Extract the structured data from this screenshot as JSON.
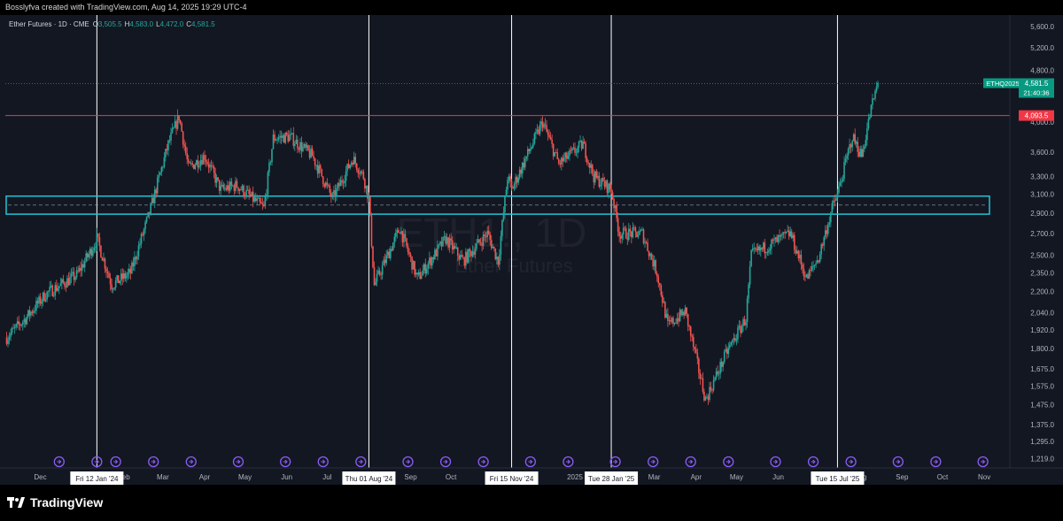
{
  "credit": "Bosslyfva created with TradingView.com, Aug 14, 2025 19:29 UTC-4",
  "footer": {
    "brand": "TradingView"
  },
  "legend": {
    "symbol": "Ether Futures · 1D · CME",
    "o_label": "O",
    "o_value": "3,505.5",
    "h_label": "H",
    "h_value": "4,583.0",
    "l_label": "L",
    "l_value": "4,472.0",
    "c_label": "C",
    "c_value": "4,581.5"
  },
  "watermark": {
    "symbol": "ETH1!, 1D",
    "name": "Ether Futures"
  },
  "colors": {
    "background": "#131722",
    "up": "#26a69a",
    "down": "#ef5350",
    "resistance": "#f23645",
    "zone": "#22c3d6",
    "price_badge": "#089981",
    "crosshair": "#ffffff"
  },
  "chart_data": {
    "type": "candlestick",
    "y_scale": "log",
    "ylim": [
      1180,
      5800
    ],
    "xlim": [
      "2023-11-05",
      "2025-11-20"
    ],
    "y_ticks": [
      "5,600.0",
      "5,200.0",
      "4,800.0",
      "4,000.0",
      "3,600.0",
      "3,300.0",
      "3,100.0",
      "2,900.0",
      "2,700.0",
      "2,500.0",
      "2,350.0",
      "2,200.0",
      "2,040.0",
      "1,920.0",
      "1,800.0",
      "1,675.0",
      "1,575.0",
      "1,475.0",
      "1,375.0",
      "1,295.0",
      "1,219.0"
    ],
    "x_ticks": [
      {
        "date": "2023-12-01",
        "label": "Dec"
      },
      {
        "date": "2024-02-01",
        "label": "Feb"
      },
      {
        "date": "2024-03-01",
        "label": "Mar"
      },
      {
        "date": "2024-04-01",
        "label": "Apr"
      },
      {
        "date": "2024-05-01",
        "label": "May"
      },
      {
        "date": "2024-06-01",
        "label": "Jun"
      },
      {
        "date": "2024-07-01",
        "label": "Jul"
      },
      {
        "date": "2024-09-01",
        "label": "Sep"
      },
      {
        "date": "2024-10-01",
        "label": "Oct"
      },
      {
        "date": "2025-01-01",
        "label": "2025"
      },
      {
        "date": "2025-03-01",
        "label": "Mar"
      },
      {
        "date": "2025-04-01",
        "label": "Apr"
      },
      {
        "date": "2025-05-01",
        "label": "May"
      },
      {
        "date": "2025-06-01",
        "label": "Jun"
      },
      {
        "date": "2025-08-01",
        "label": "Aug"
      },
      {
        "date": "2025-09-01",
        "label": "Sep"
      },
      {
        "date": "2025-10-01",
        "label": "Oct"
      },
      {
        "date": "2025-11-01",
        "label": "Nov"
      }
    ],
    "vertical_markers": [
      {
        "date": "2024-01-12",
        "label": "Fri 12 Jan '24"
      },
      {
        "date": "2024-08-01",
        "label": "Thu 01 Aug '24"
      },
      {
        "date": "2024-11-15",
        "label": "Fri 15 Nov '24"
      },
      {
        "date": "2025-01-28",
        "label": "Tue 28 Jan '25"
      },
      {
        "date": "2025-07-15",
        "label": "Tue 15 Jul '25"
      }
    ],
    "horizontal_line": {
      "price": 4093.5,
      "label": "4,093.5"
    },
    "zone": {
      "low": 2890,
      "high": 3080,
      "mid": 2985
    },
    "last_price": {
      "price": 4581.5,
      "symbol": "ETHQ2025",
      "label": "4,581.5",
      "countdown": "21:40:36"
    },
    "event_markers": [
      "2023-12-15",
      "2024-01-12",
      "2024-01-26",
      "2024-02-23",
      "2024-03-22",
      "2024-04-26",
      "2024-05-31",
      "2024-06-28",
      "2024-07-26",
      "2024-08-30",
      "2024-09-27",
      "2024-10-25",
      "2024-11-29",
      "2024-12-27",
      "2025-01-31",
      "2025-02-28",
      "2025-03-28",
      "2025-04-25",
      "2025-05-30",
      "2025-06-27",
      "2025-07-25",
      "2025-08-29",
      "2025-09-26",
      "2025-10-31"
    ],
    "anchors": [
      [
        "2023-11-06",
        1870
      ],
      [
        "2023-11-20",
        2000
      ],
      [
        "2023-12-05",
        2180
      ],
      [
        "2023-12-28",
        2330
      ],
      [
        "2024-01-08",
        2550
      ],
      [
        "2024-01-12",
        2650
      ],
      [
        "2024-01-23",
        2250
      ],
      [
        "2024-02-06",
        2350
      ],
      [
        "2024-02-20",
        2900
      ],
      [
        "2024-03-05",
        3700
      ],
      [
        "2024-03-13",
        4080
      ],
      [
        "2024-03-20",
        3400
      ],
      [
        "2024-04-01",
        3550
      ],
      [
        "2024-04-13",
        3150
      ],
      [
        "2024-04-25",
        3200
      ],
      [
        "2024-05-15",
        2950
      ],
      [
        "2024-05-22",
        3780
      ],
      [
        "2024-06-03",
        3800
      ],
      [
        "2024-06-20",
        3550
      ],
      [
        "2024-07-05",
        3050
      ],
      [
        "2024-07-20",
        3520
      ],
      [
        "2024-07-28",
        3300
      ],
      [
        "2024-08-01",
        3050
      ],
      [
        "2024-08-05",
        2250
      ],
      [
        "2024-08-24",
        2750
      ],
      [
        "2024-09-06",
        2300
      ],
      [
        "2024-09-27",
        2650
      ],
      [
        "2024-10-10",
        2450
      ],
      [
        "2024-10-28",
        2700
      ],
      [
        "2024-11-05",
        2450
      ],
      [
        "2024-11-12",
        3300
      ],
      [
        "2024-11-15",
        3150
      ],
      [
        "2024-11-25",
        3500
      ],
      [
        "2024-12-08",
        4000
      ],
      [
        "2024-12-20",
        3450
      ],
      [
        "2025-01-07",
        3700
      ],
      [
        "2025-01-15",
        3300
      ],
      [
        "2025-01-28",
        3150
      ],
      [
        "2025-02-03",
        2700
      ],
      [
        "2025-02-20",
        2700
      ],
      [
        "2025-03-03",
        2350
      ],
      [
        "2025-03-11",
        1950
      ],
      [
        "2025-03-24",
        2050
      ],
      [
        "2025-04-08",
        1500
      ],
      [
        "2025-04-24",
        1780
      ],
      [
        "2025-05-08",
        2000
      ],
      [
        "2025-05-12",
        2500
      ],
      [
        "2025-06-10",
        2700
      ],
      [
        "2025-06-22",
        2300
      ],
      [
        "2025-07-01",
        2480
      ],
      [
        "2025-07-11",
        2950
      ],
      [
        "2025-07-15",
        3100
      ],
      [
        "2025-07-26",
        3800
      ],
      [
        "2025-08-02",
        3550
      ],
      [
        "2025-08-09",
        4200
      ],
      [
        "2025-08-14",
        4581.5
      ]
    ]
  }
}
